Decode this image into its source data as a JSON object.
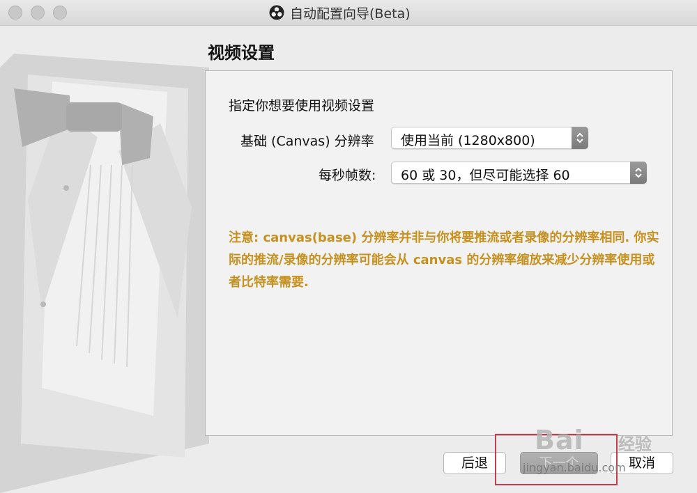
{
  "window": {
    "title": "自动配置向导(Beta)",
    "app_icon": "obs-icon",
    "controls": [
      "close",
      "minimize",
      "zoom"
    ]
  },
  "page": {
    "title": "视频设置",
    "description": "指定你想要使用视频设置"
  },
  "fields": {
    "resolution": {
      "label": "基础 (Canvas) 分辨率",
      "value": "使用当前 (1280x800)"
    },
    "fps": {
      "label": "每秒帧数:",
      "value": "60 或 30，但尽可能选择 60"
    }
  },
  "note": "注意: canvas(base) 分辨率并非与你将要推流或者录像的分辨率相同. 你实际的推流/录像的分辨率可能会从 canvas 的分辨率缩放来减少分辨率使用或者比特率需要.",
  "buttons": {
    "back": "后退",
    "next": "下一个",
    "cancel": "取消"
  },
  "watermark": {
    "brand": "Bai",
    "brand_suffix": "经验",
    "url": "jingyan.baidu.com"
  },
  "colors": {
    "note_text": "#c7911f",
    "highlight_box": "#c63c4a"
  }
}
